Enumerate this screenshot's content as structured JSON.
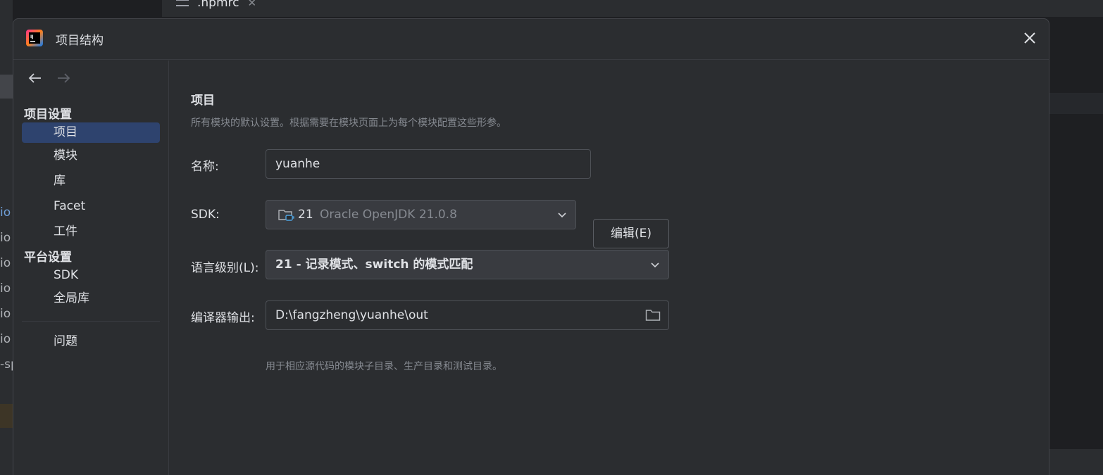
{
  "background": {
    "tab_label": ".npmrc",
    "left_fragments": [
      "io",
      "io",
      "io",
      "io",
      "io",
      "io",
      "-sp"
    ]
  },
  "dialog": {
    "title": "项目结构"
  },
  "sidebar": {
    "section_project_settings": "项目设置",
    "section_platform_settings": "平台设置",
    "items": [
      {
        "label": "项目",
        "active": true
      },
      {
        "label": "模块"
      },
      {
        "label": "库"
      },
      {
        "label": "Facet"
      },
      {
        "label": "工件"
      },
      {
        "label": "SDK"
      },
      {
        "label": "全局库"
      },
      {
        "label": "问题"
      }
    ]
  },
  "content": {
    "heading": "项目",
    "description": "所有模块的默认设置。根据需要在模块页面上为每个模块配置这些形参。",
    "name_label": "名称:",
    "name_value": "yuanhe",
    "sdk_label": "SDK:",
    "sdk_version": "21",
    "sdk_name": "Oracle OpenJDK 21.0.8",
    "edit_button": "编辑(E)",
    "language_level_label": "语言级别(L):",
    "language_level_value": "21 - 记录模式、switch 的模式匹配",
    "compiler_output_label": "编译器输出:",
    "compiler_output_value": "D:\\fangzheng\\yuanhe\\out",
    "compiler_output_hint": "用于相应源代码的模块子目录、生产目录和测试目录。"
  }
}
